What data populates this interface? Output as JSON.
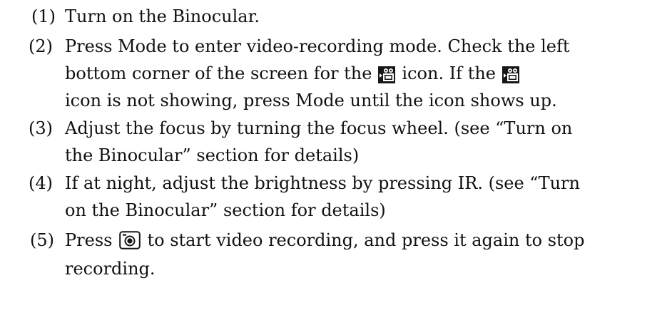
{
  "steps": [
    {
      "number": "(1)",
      "lines": [
        "Turn on the Binocular."
      ]
    },
    {
      "number": "(2)",
      "line_1": "Press Mode to enter video-recording mode. Check the left",
      "line_2_before_icon": "bottom corner of the screen for the",
      "line_2_middle": "icon. If the",
      "line_3": "icon is not showing, press Mode until the icon shows up.",
      "icon": "video-mode-icon"
    },
    {
      "number": "(3)",
      "lines": [
        "Adjust the focus by turning the focus wheel. (see “Turn on",
        "the Binocular” section for details)"
      ]
    },
    {
      "number": "(4)",
      "lines": [
        "If at night, adjust the brightness by pressing IR. (see “Turn",
        "on the Binocular” section for details)"
      ]
    },
    {
      "number": "(5)",
      "line_1_before_icon": "Press",
      "line_1_after_icon": "to start video recording, and press it again to stop",
      "line_2": "recording.",
      "icon": "camera-shutter-icon"
    }
  ]
}
